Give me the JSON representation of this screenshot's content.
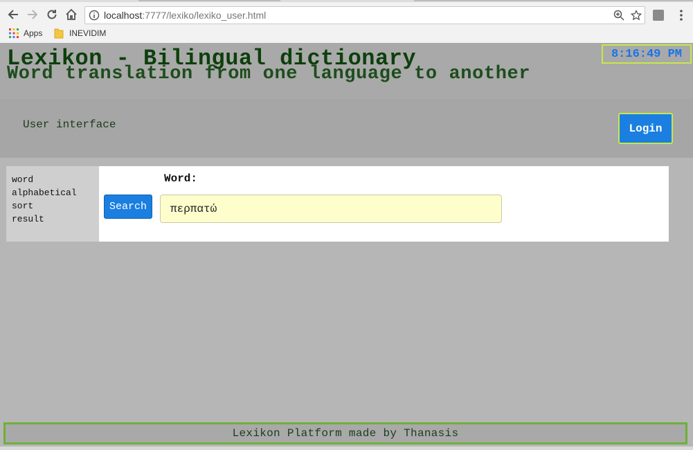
{
  "browser": {
    "url_host": "localhost",
    "url_path": ":7777/lexiko/lexiko_user.html",
    "bookmarks": [
      {
        "label": "Apps",
        "icon": "apps-grid-icon"
      },
      {
        "label": "INEVIDIM",
        "icon": "folder-icon"
      }
    ]
  },
  "header": {
    "title": "Lexikon - Bilingual dictionary",
    "subtitle": "Word translation from one language to another",
    "clock": "8:16:49 PM"
  },
  "subheader": {
    "section_title": "User interface",
    "login_label": "Login"
  },
  "sidebar": {
    "items": [
      {
        "label": "word"
      },
      {
        "label": "alphabetical"
      },
      {
        "label": "sort"
      },
      {
        "label": "result"
      }
    ]
  },
  "search": {
    "word_label": "Word:",
    "button_label": "Search",
    "input_value": "περπατώ"
  },
  "footer": {
    "text": "Lexikon Platform made by Thanasis"
  },
  "colors": {
    "page_bg": "#b6b6b6",
    "header_text": "#0d3f0d",
    "accent_blue": "#1a7fe0",
    "clock_blue": "#1a73e8",
    "highlight_border": "#c5e84c",
    "footer_border": "#6faf3a",
    "input_bg": "#fdfecb"
  }
}
